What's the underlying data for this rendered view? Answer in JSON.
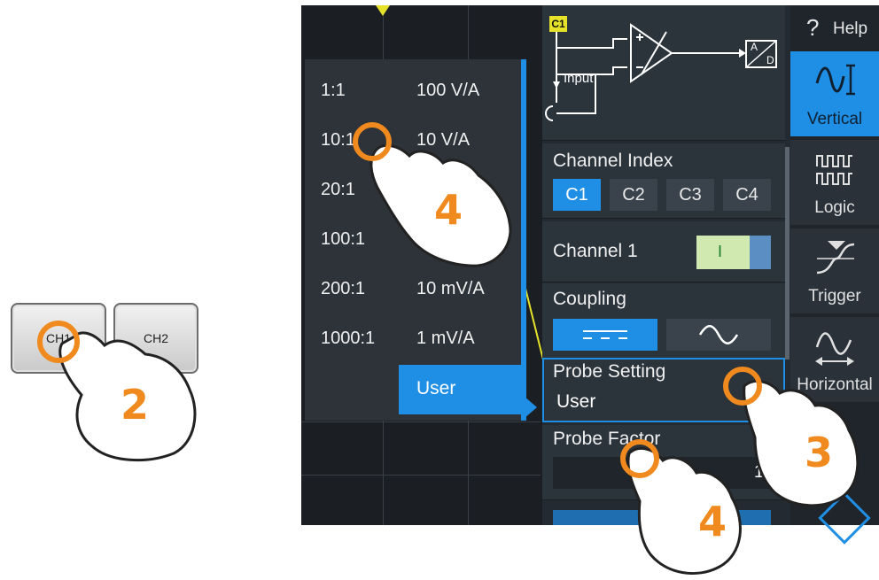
{
  "hardware": {
    "ch1_label": "CH1",
    "ch2_label": "CH2"
  },
  "probe_list": {
    "items": [
      {
        "ratio": "1:1",
        "value": "100 V/A"
      },
      {
        "ratio": "10:1",
        "value": "10 V/A"
      },
      {
        "ratio": "20:1",
        "value": ""
      },
      {
        "ratio": "100:1",
        "value": ""
      },
      {
        "ratio": "200:1",
        "value": "10 mV/A"
      },
      {
        "ratio": "1000:1",
        "value": "1 mV/A"
      }
    ],
    "user_label": "User"
  },
  "panel": {
    "channel_badge": "C1",
    "diagram": {
      "input_label": "Input",
      "adc_a": "A",
      "adc_d": "D"
    },
    "channel_index": {
      "title": "Channel Index",
      "options": [
        "C1",
        "C2",
        "C3",
        "C4"
      ],
      "selected": "C1"
    },
    "channel1": {
      "title": "Channel 1",
      "toggle_label": "I"
    },
    "coupling": {
      "title": "Coupling"
    },
    "probe_setting": {
      "title": "Probe Setting",
      "value": "User"
    },
    "probe_factor": {
      "title": "Probe Factor",
      "value": "1"
    }
  },
  "nav": {
    "help": "Help",
    "help_mark": "?",
    "items": [
      {
        "label": "Vertical"
      },
      {
        "label": "Logic"
      },
      {
        "label": "Trigger"
      },
      {
        "label": "Horizontal"
      }
    ],
    "selected": "Vertical"
  },
  "steps": {
    "hand_2": "2",
    "hand_3": "3",
    "hand_4a": "4",
    "hand_4b": "4"
  },
  "colors": {
    "accent": "#1f8fe6",
    "callout": "#f08a1e",
    "channel_yellow": "#e6e22a"
  }
}
